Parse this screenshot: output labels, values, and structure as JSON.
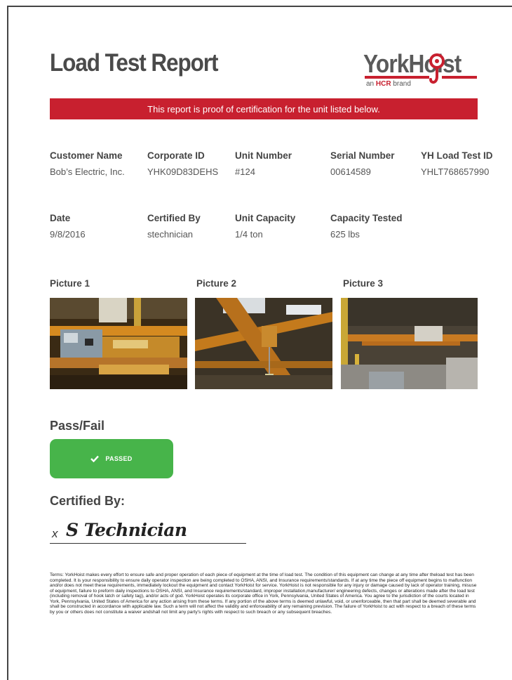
{
  "title": "Load Test Report",
  "logo": {
    "word": "YorkHoist",
    "sub_prefix": "an ",
    "sub_brand": "HCR",
    "sub_suffix": " brand"
  },
  "banner": "This report is proof of certification for the unit listed below.",
  "row1": [
    {
      "label": "Customer Name",
      "value": "Bob’s Electric, Inc."
    },
    {
      "label": "Corporate ID",
      "value": "YHK09D83DEHS"
    },
    {
      "label": "Unit Number",
      "value": "#124"
    },
    {
      "label": "Serial Number",
      "value": "00614589"
    },
    {
      "label": "YH Load Test ID",
      "value": "YHLT768657990"
    }
  ],
  "row2": [
    {
      "label": "Date",
      "value": "9/8/2016"
    },
    {
      "label": "Certified By",
      "value": "stechnician"
    },
    {
      "label": "Unit Capacity",
      "value": "1/4 ton"
    },
    {
      "label": "Capacity Tested",
      "value": "625 lbs"
    }
  ],
  "pictures": [
    {
      "label": "Picture 1"
    },
    {
      "label": "Picture 2"
    },
    {
      "label": "Picture 3"
    }
  ],
  "pass_fail": {
    "label": "Pass/Fail",
    "status": "PASSED",
    "color": "#47b44a"
  },
  "certified": {
    "label": "Certified By:",
    "x_mark": "x",
    "signature": "S Technician"
  },
  "terms": "Terms: YorkHoist makes every effort to ensure safe and proper operation of each piece of equipment at the time of load test. The condition of this equipment can change at any time after theload test has been completed. It is your responsibility to ensure daily operator inspection are being completed to OSHA, ANSI, and Insurance requirements/standards. If at any time the piece off equipment begins to malfunction and/or does not meet these requirements, immediately lockout the equipment and contact YorkHoist for service. YorkHoist is not responsible for any injury or damage caused by lack of operator training, misuse of equipment, failure to preform daily inspections to OSHA, ANSI, and Insurance requirements/standard, improper installation,manufacturer/ engineering defects, changes or alterations made after the load test (including removal of hook latch or safety tag), and/or acts of god. YorkHoist operates its corporate office in York, Pennsylvania, United States of America. You agree to the jurisdiction of the courts located in York, Pennsylvania, United States of America for any action arising from these terms. If any portion of the above terms is deemed unlawful, void, or unenforceable, then that part shall be deemed severable and shall be constructed in accordance with applicable law. Such a term will not affect the validity and enforceability of any remaining prevision. The failure of YorkHoist to act with respect to a breach of these terms by you or others does not constitute a waiver andshall not limit any party's rights with respect to such breach or any subsequent breaches.",
  "colors": {
    "brand_red": "#c8202f",
    "pass_green": "#47b44a"
  }
}
